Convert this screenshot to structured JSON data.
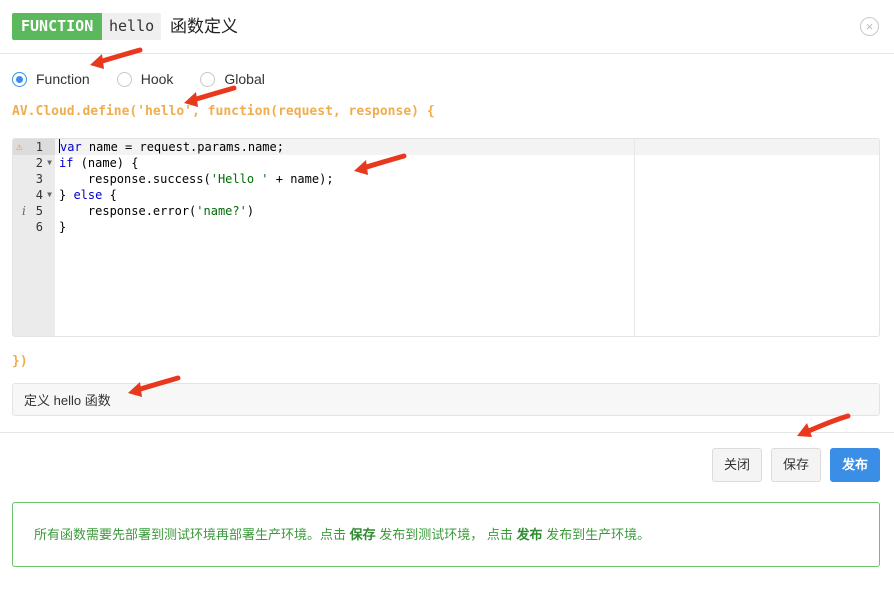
{
  "header": {
    "badge": "FUNCTION",
    "function_name": "hello",
    "title": "函数定义",
    "close_symbol": "×"
  },
  "type_options": {
    "selected": "Function",
    "items": [
      "Function",
      "Hook",
      "Global"
    ]
  },
  "code": {
    "prefix": "AV.Cloud.define('hello', function(request, response) {",
    "suffix": "})",
    "lines": [
      "var name = request.params.name;",
      "if (name) {",
      "    response.success('Hello ' + name);",
      "} else {",
      "    response.error('name?')",
      "}"
    ],
    "line_numbers": [
      "1",
      "2",
      "3",
      "4",
      "5",
      "6"
    ],
    "warning_icon_line": 1,
    "info_icon_line": 5,
    "fold_lines": [
      2,
      4
    ]
  },
  "description": {
    "value": "定义 hello 函数"
  },
  "buttons": {
    "close": "关闭",
    "save": "保存",
    "publish": "发布"
  },
  "notice": {
    "part1": "所有函数需要先部署到测试环境再部署生产环境。点击 ",
    "save_word": "保存",
    "part2": " 发布到测试环境， 点击 ",
    "publish_word": "发布",
    "part3": " 发布到生产环境。"
  },
  "colors": {
    "badge_green": "#5cb85c",
    "accent_blue": "#3a8ee6",
    "code_orange": "#f0ad4e",
    "notice_green": "#3c9a3c",
    "annotation_arrow": "#e8381e"
  },
  "icons": {
    "close": "close-icon",
    "warning": "warning-icon",
    "info": "info-icon",
    "fold": "fold-toggle-icon",
    "annotation": "red-arrow-annotation"
  }
}
